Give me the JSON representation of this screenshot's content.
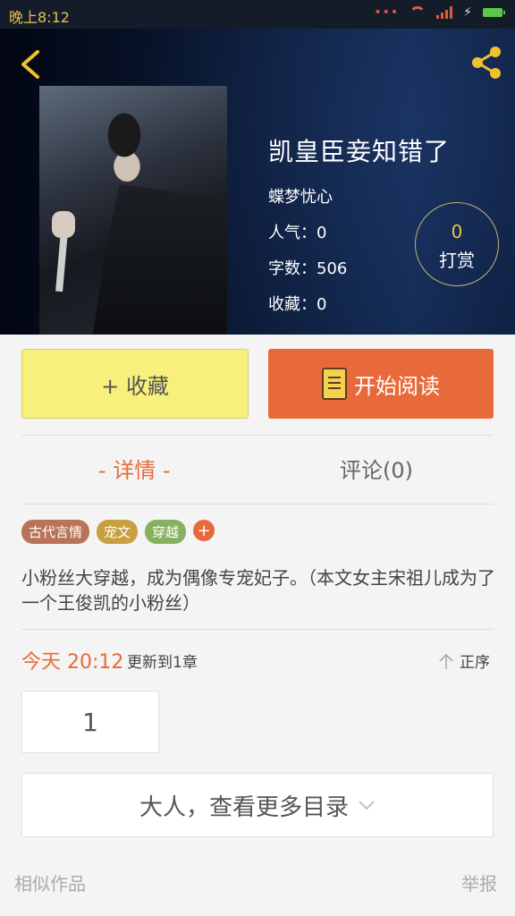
{
  "status_bar": {
    "time": "晚上8:12"
  },
  "book": {
    "title": "凯皇臣妾知错了",
    "author": "蝶梦忧心",
    "popularity": "人气：0",
    "word_count": "字数：506",
    "favorites": "收藏：0"
  },
  "tip": {
    "count": "0",
    "label": "打赏"
  },
  "actions": {
    "collect_label": "+ 收藏",
    "read_label": "开始阅读"
  },
  "tabs": {
    "detail": "- 详情 -",
    "comments": "评论(0)"
  },
  "tags": [
    {
      "label": "古代言情",
      "color": "#b8735a"
    },
    {
      "label": "宠文",
      "color": "#c8a040"
    },
    {
      "label": "穿越",
      "color": "#88b060"
    }
  ],
  "tag_add_label": "+",
  "description": "小粉丝大穿越，成为偶像专宠妃子。（本文女主宋祖儿成为了一个王俊凯的小粉丝）",
  "update": {
    "time": "今天 20:12",
    "text": "更新到1章",
    "sort_label": "正序"
  },
  "pagination": {
    "page": "1"
  },
  "more_catalog": "大人，查看更多目录",
  "footer": {
    "similar": "相似作品",
    "report": "举报"
  },
  "colors": {
    "accent": "#e8693a",
    "collect_bg": "#f8f07c",
    "hero_dark": "#0b1934"
  }
}
